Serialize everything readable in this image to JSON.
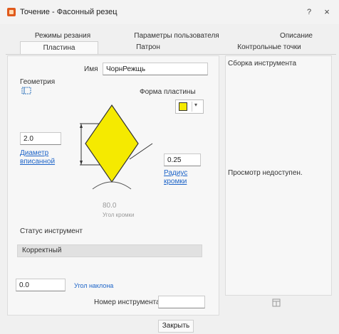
{
  "window": {
    "title": "Точение - Фасонный резец",
    "help": "?",
    "close": "×"
  },
  "tabs": {
    "row1": [
      "Режимы резания",
      "Параметры пользователя",
      "Описание"
    ],
    "row2": [
      "Пластина",
      "Патрон",
      "Контрольные точки"
    ],
    "active": "Пластина"
  },
  "insert": {
    "name_label": "Имя",
    "name_value": "ЧорнРежщь",
    "geometry_label": "Геометрия",
    "shape_label": "Форма пластины",
    "diameter_value": "2.0",
    "diameter_link": "Диаметр вписанной",
    "radius_value": "0.25",
    "radius_link": "Радиус кромки",
    "angle_value": "80.0",
    "angle_label": "Угол кромки",
    "tool_status_label": "Статус инструмент",
    "tool_status_value": "Корректный",
    "pitch_value": "0.0",
    "pitch_link": "Угол наклона",
    "tool_number_label": "Номер инструмента",
    "tool_number_value": ""
  },
  "assembly": {
    "header": "Сборка инструмента",
    "preview_text": "Просмотр недоступен."
  },
  "footer": {
    "close_button": "Закрыть"
  },
  "colors": {
    "insert_fill": "#f5ea00",
    "accent": "#e05a1c",
    "link": "#1d64c8"
  }
}
